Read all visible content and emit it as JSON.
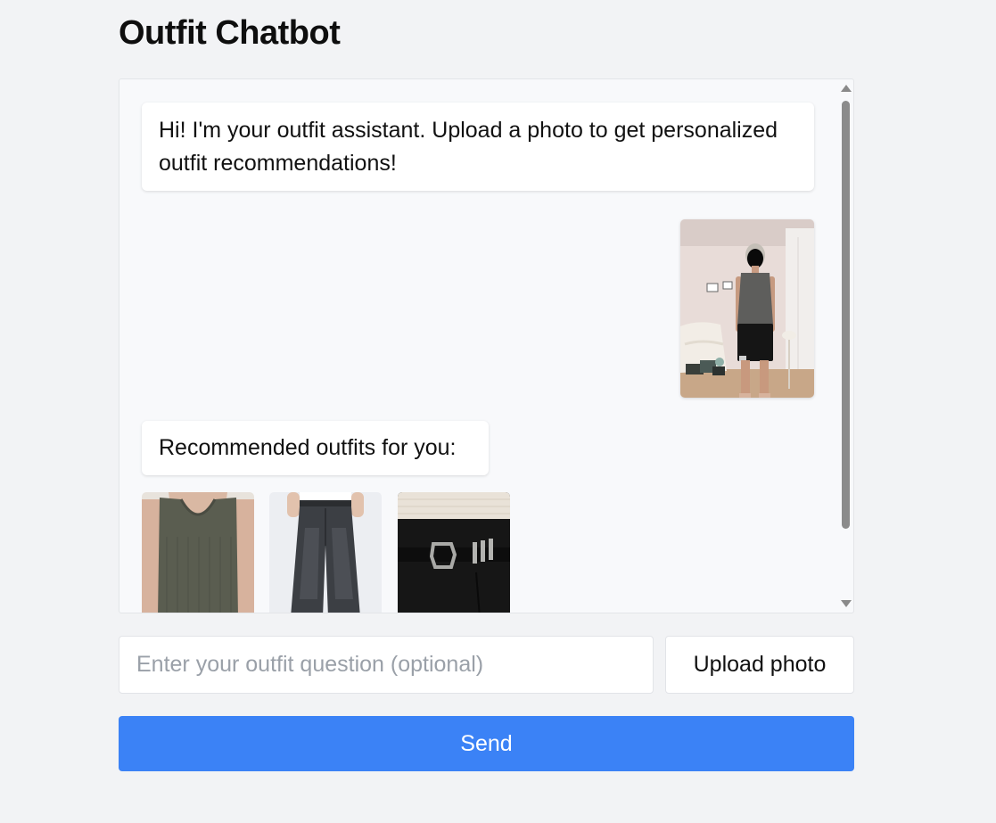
{
  "app": {
    "title": "Outfit Chatbot"
  },
  "chat": {
    "messages": [
      {
        "role": "assistant",
        "text": "Hi! I'm your outfit assistant. Upload a photo to get personalized outfit recommendations!"
      },
      {
        "role": "user",
        "image": "user-outfit-photo"
      },
      {
        "role": "assistant",
        "text": "Recommended outfits for you:"
      }
    ],
    "recommendations": [
      {
        "image": "gray-tank-top-photo"
      },
      {
        "image": "black-wide-leg-jeans-photo"
      },
      {
        "image": "black-trousers-with-belt-photo"
      }
    ]
  },
  "input": {
    "value": "",
    "placeholder": "Enter your outfit question (optional)"
  },
  "buttons": {
    "upload_label": "Upload photo",
    "send_label": "Send"
  },
  "colors": {
    "accent": "#3b82f6",
    "page_background": "#f2f3f5",
    "chat_background": "#f8f9fb"
  }
}
